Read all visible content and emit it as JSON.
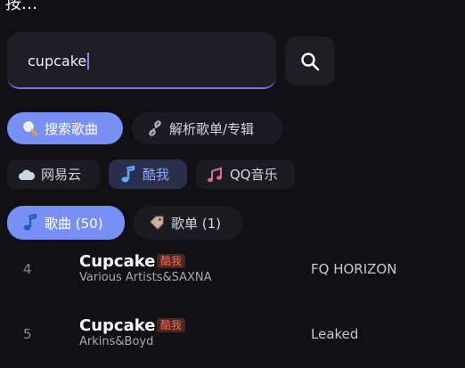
{
  "search": {
    "query": "cupcake"
  },
  "modes": [
    {
      "label": "搜索歌曲"
    },
    {
      "label": "解析歌单/专辑"
    }
  ],
  "sources": [
    {
      "label": "网易云"
    },
    {
      "label": "酷我"
    },
    {
      "label": "QQ音乐"
    }
  ],
  "result_tabs": [
    {
      "label": "歌曲 (50)"
    },
    {
      "label": "歌单 (1)"
    }
  ],
  "songs": [
    {
      "rank": "4",
      "title": "Cupcake",
      "source_badge": "酷我",
      "artist": "Various Artists&SAXNA",
      "album": "FQ HORIZON"
    },
    {
      "rank": "5",
      "title": "Cupcake",
      "source_badge": "酷我",
      "artist": "Arkins&Boyd",
      "album": "Leaked"
    }
  ],
  "colors": {
    "accent": "#7890f5",
    "badge": "#ff6a4a",
    "background": "#111014"
  }
}
